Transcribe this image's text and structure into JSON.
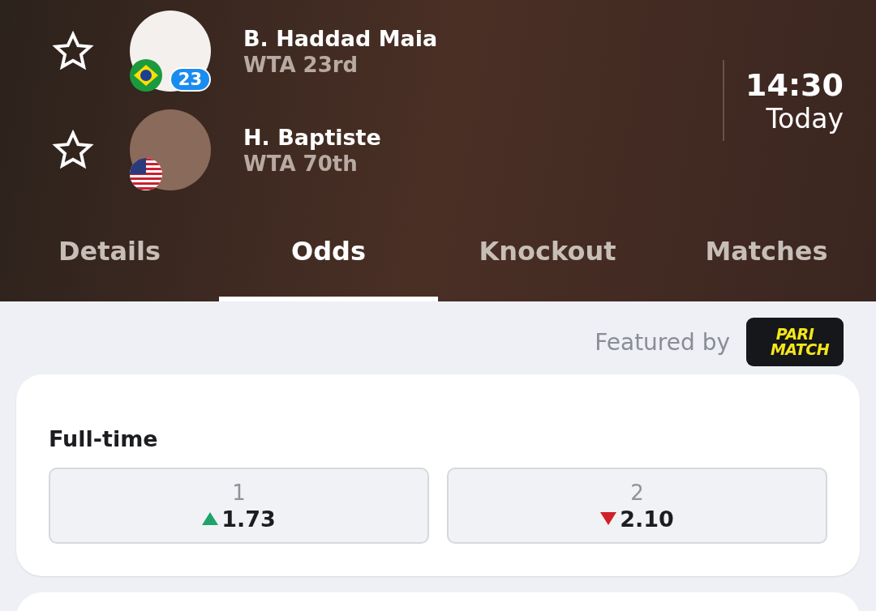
{
  "players": [
    {
      "name": "B. Haddad Maia",
      "ranking": "WTA 23rd",
      "favorite": false,
      "kind": "brazil",
      "seed": "23"
    },
    {
      "name": "H. Baptiste",
      "ranking": "WTA 70th",
      "favorite": false,
      "kind": "usa"
    }
  ],
  "start": {
    "time": "14:30",
    "day": "Today"
  },
  "tabs": [
    {
      "label": "Details",
      "selected": false
    },
    {
      "label": "Odds",
      "selected": true
    },
    {
      "label": "Knockout",
      "selected": false
    },
    {
      "label": "Matches",
      "selected": false
    }
  ],
  "sponsor": {
    "text": "Featured by",
    "logo_lines": [
      "PARI",
      "MATCH"
    ]
  },
  "market": {
    "title": "Full-time",
    "outcomes": [
      {
        "label": "1",
        "odds": "1.73",
        "kind": "up"
      },
      {
        "label": "2",
        "odds": "2.10",
        "kind": "down"
      }
    ]
  }
}
